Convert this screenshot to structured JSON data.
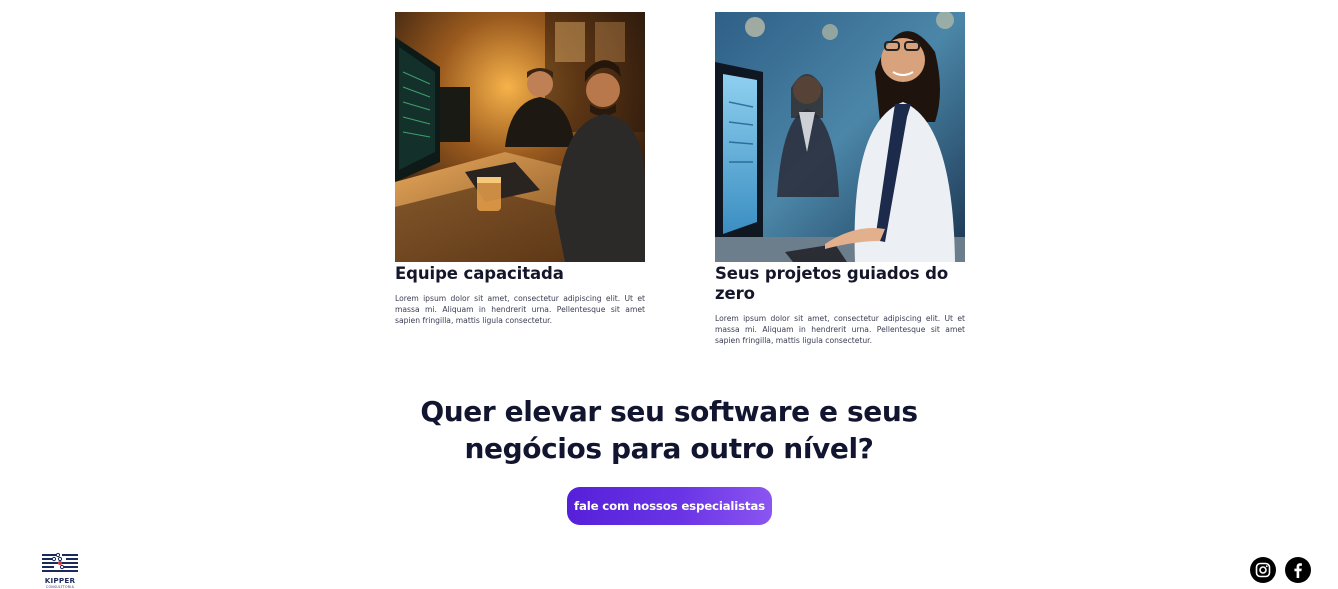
{
  "cards": [
    {
      "title": "Equipe capacitada",
      "text": "Lorem ipsum dolor sit amet, consectetur adipiscing elit. Ut et massa mi. Aliquam in hendrerit urna. Pellentesque sit amet sapien fringilla, mattis ligula consectetur.",
      "image": "team-working-at-computers-photo"
    },
    {
      "title": "Seus projetos guiados do zero",
      "text": "Lorem ipsum dolor sit amet, consectetur adipiscing elit. Ut et massa mi. Aliquam in hendrerit urna. Pellentesque sit amet sapien fringilla, mattis ligula consectetur.",
      "image": "smiling-professional-woman-photo"
    }
  ],
  "cta": {
    "heading_line1": "Quer elevar seu software e seus",
    "heading_line2": "negócios para outro nível?",
    "button_label": "fale com nossos especialistas"
  },
  "footer": {
    "logo_name": "KIPPER",
    "logo_sub": "CONSULTTORIA",
    "social": [
      "instagram-icon",
      "facebook-icon"
    ]
  },
  "colors": {
    "heading": "#121530",
    "button_gradient_start": "#5520d8",
    "button_gradient_end": "#8a55f0",
    "logo": "#1b2a5c"
  }
}
